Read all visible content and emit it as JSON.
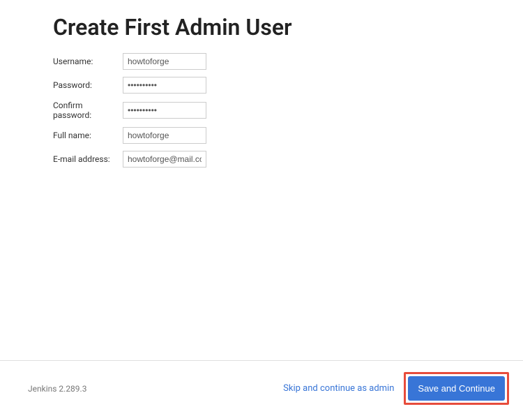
{
  "page": {
    "title": "Create First Admin User"
  },
  "form": {
    "username": {
      "label": "Username:",
      "value": "howtoforge"
    },
    "password": {
      "label": "Password:",
      "value": "••••••••••"
    },
    "confirm_password": {
      "label": "Confirm password:",
      "value": "••••••••••"
    },
    "full_name": {
      "label": "Full name:",
      "value": "howtoforge"
    },
    "email": {
      "label": "E-mail address:",
      "value": "howtoforge@mail.com"
    }
  },
  "footer": {
    "version": "Jenkins 2.289.3",
    "skip_label": "Skip and continue as admin",
    "save_label": "Save and Continue"
  }
}
